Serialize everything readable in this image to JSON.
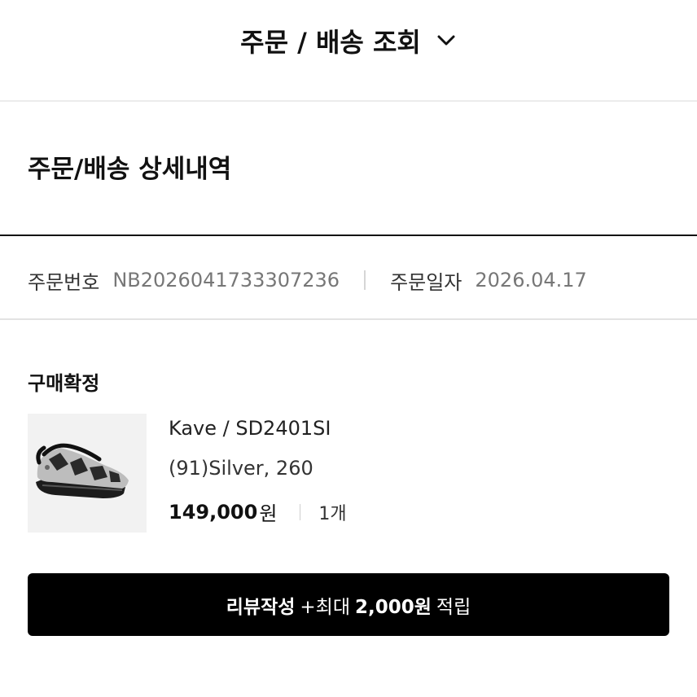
{
  "header": {
    "title": "주문 / 배송 조회"
  },
  "section": {
    "title": "주문/배송 상세내역"
  },
  "order": {
    "number_label": "주문번호",
    "number_value": "NB2026041733307236",
    "date_label": "주문일자",
    "date_value": "2026.04.17"
  },
  "status": "구매확정",
  "product": {
    "name": "Kave / SD2401SI",
    "option": "(91)Silver, 260",
    "price": "149,000",
    "currency": "원",
    "quantity": "1개",
    "image_icon": "sneaker-icon"
  },
  "cta": {
    "label": "리뷰작성",
    "prefix": "+최대",
    "amount": "2,000원",
    "suffix": "적립"
  },
  "icons": {
    "header_toggle": "chevron-down-icon"
  }
}
